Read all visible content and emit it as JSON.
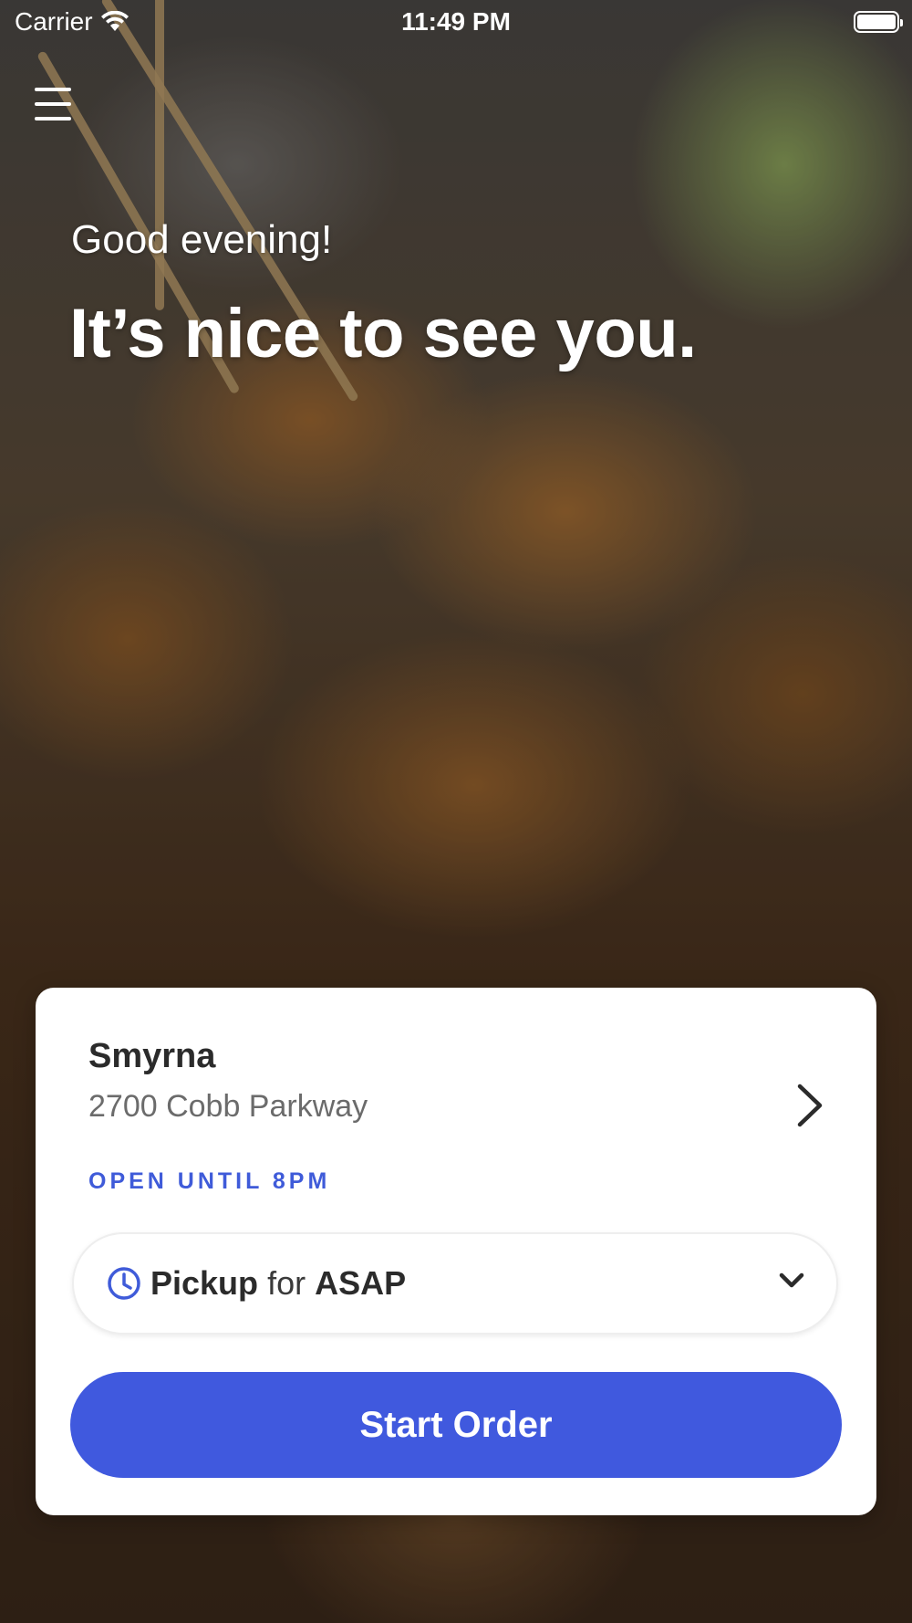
{
  "status_bar": {
    "carrier": "Carrier",
    "time": "11:49 PM"
  },
  "greeting": "Good evening!",
  "headline": "It’s nice to see you.",
  "location": {
    "name": "Smyrna",
    "address": "2700 Cobb Parkway",
    "hours": "OPEN UNTIL 8PM"
  },
  "fulfillment": {
    "method": "Pickup",
    "connector": "for",
    "time": "ASAP"
  },
  "start_order_label": "Start Order",
  "colors": {
    "accent": "#4059de",
    "card": "#ffffff",
    "text": "#2b2b2b"
  },
  "icons": [
    "wifi-icon",
    "battery-icon",
    "menu-icon",
    "chevron-right-icon",
    "clock-icon",
    "chevron-down-icon"
  ]
}
